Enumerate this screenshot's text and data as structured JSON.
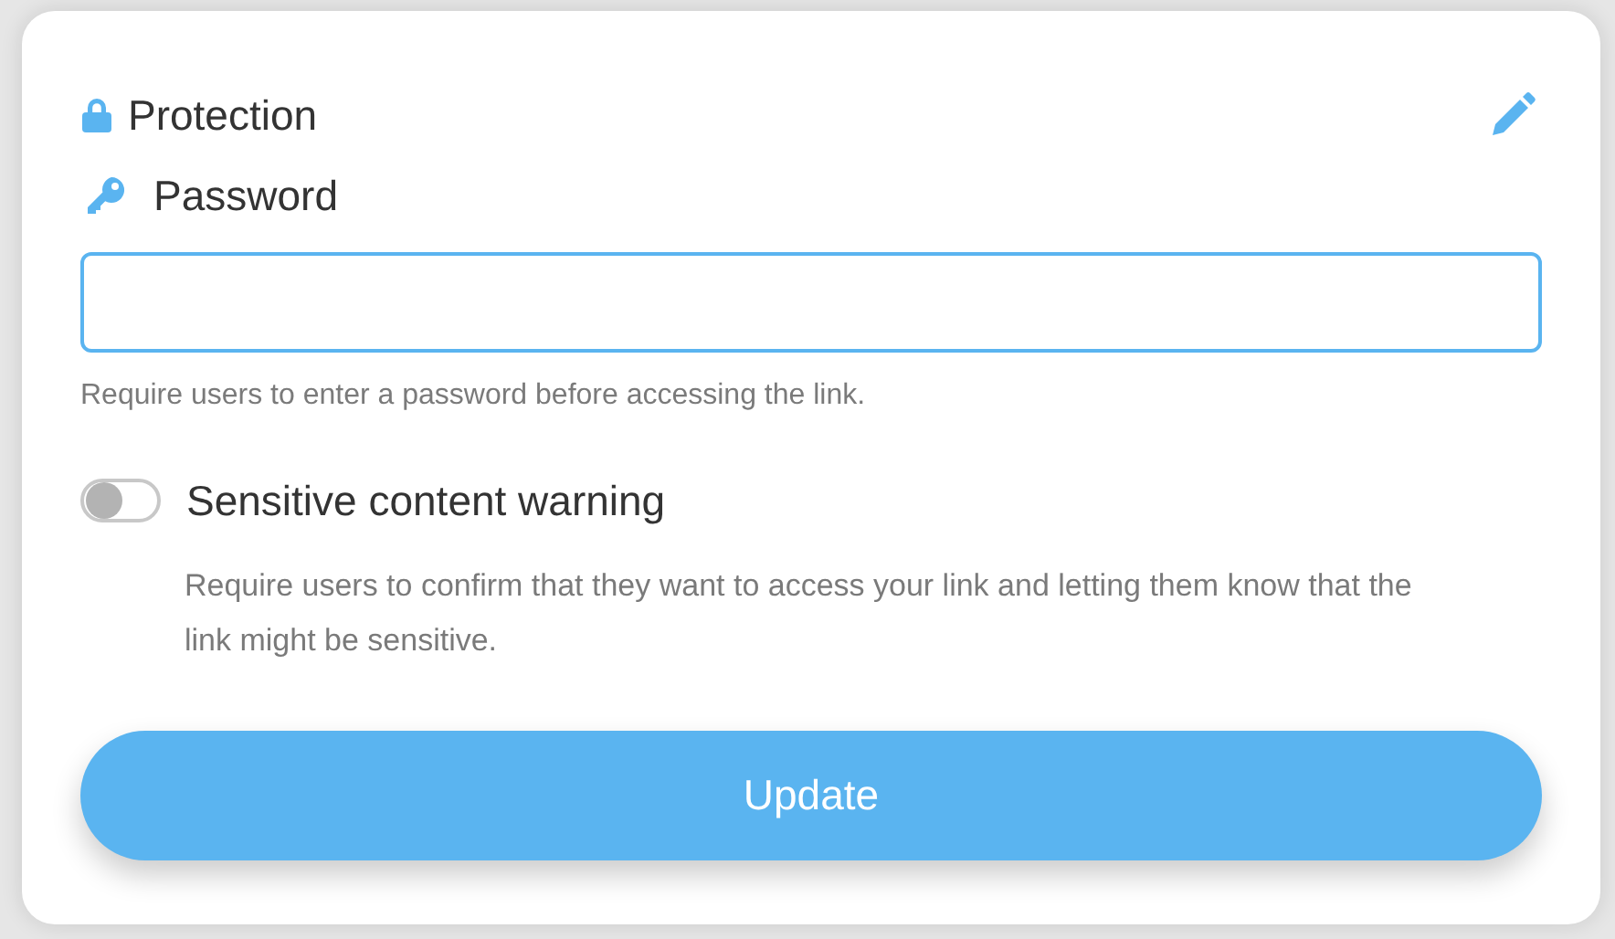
{
  "section": {
    "title": "Protection"
  },
  "password": {
    "label": "Password",
    "help": "Require users to enter a password before accessing the link."
  },
  "sensitive": {
    "label": "Sensitive content warning",
    "on": false,
    "description": "Require users to confirm that they want to access your link and letting them know that the link might be sensitive."
  },
  "submit": {
    "label": "Update"
  }
}
